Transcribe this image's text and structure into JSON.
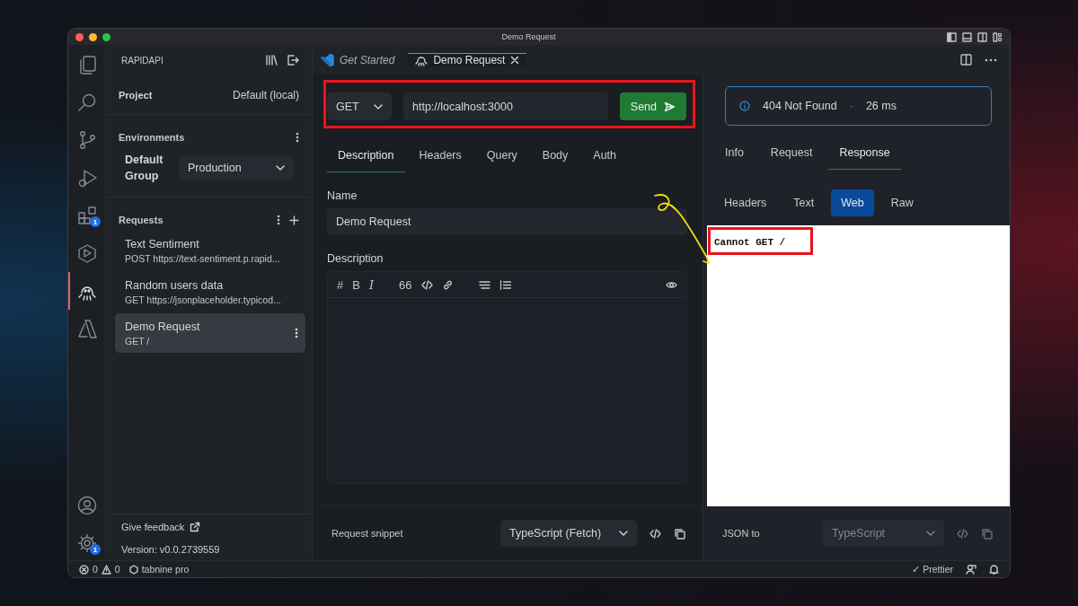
{
  "window": {
    "title": "Demo Request"
  },
  "activity_bar": {
    "items": [
      {
        "kind": "files",
        "selected": false
      },
      {
        "kind": "search",
        "selected": false
      },
      {
        "kind": "source-control",
        "selected": false
      },
      {
        "kind": "run",
        "selected": false
      },
      {
        "kind": "extensions",
        "selected": false,
        "badge": "1"
      },
      {
        "kind": "hexagon",
        "selected": false
      },
      {
        "kind": "rapidapi",
        "selected": true
      },
      {
        "kind": "azure",
        "selected": false
      }
    ],
    "bottom_items": [
      {
        "kind": "account",
        "selected": false
      },
      {
        "kind": "settings",
        "selected": false,
        "badge": "1"
      }
    ]
  },
  "sidebar": {
    "title": "RAPIDAPI",
    "project": {
      "label": "Project",
      "value": "Default (local)"
    },
    "environments": {
      "title": "Environments",
      "group": "Default Group",
      "value": "Production"
    },
    "requests": {
      "title": "Requests",
      "items": [
        {
          "name": "Text Sentiment",
          "subtitle": "POST https://text-sentiment.p.rapid...",
          "selected": false
        },
        {
          "name": "Random users data",
          "subtitle": "GET https://jsonplaceholder.typicod...",
          "selected": false
        },
        {
          "name": "Demo Request",
          "subtitle": "GET /",
          "selected": true
        }
      ]
    },
    "feedback": "Give feedback",
    "version": "Version: v0.0.2739559"
  },
  "tabs": [
    {
      "label": "Get Started",
      "kind": "welcome",
      "selected": false
    },
    {
      "label": "Demo Request",
      "kind": "request",
      "selected": true
    }
  ],
  "request": {
    "method": "GET",
    "url": "http://localhost:3000",
    "send": "Send",
    "tabs": [
      {
        "label": "Description",
        "selected": true
      },
      {
        "label": "Headers",
        "selected": false
      },
      {
        "label": "Query",
        "selected": false
      },
      {
        "label": "Body",
        "selected": false
      },
      {
        "label": "Auth",
        "selected": false
      }
    ],
    "name_label": "Name",
    "name_value": "Demo Request",
    "description_label": "Description",
    "toolbar": [
      {
        "kind": "glyph",
        "text": "#"
      },
      {
        "kind": "glyph",
        "text": "B"
      },
      {
        "kind": "italic",
        "text": "I"
      },
      {
        "kind": "gap"
      },
      {
        "kind": "glyph",
        "text": "66"
      },
      {
        "kind": "code"
      },
      {
        "kind": "link"
      },
      {
        "kind": "gap"
      },
      {
        "kind": "bullets"
      },
      {
        "kind": "numbers"
      }
    ],
    "snippet_label": "Request snippet",
    "snippet_language": "TypeScript (Fetch)"
  },
  "response": {
    "status": "404 Not Found",
    "separator": "·",
    "time": "26 ms",
    "tabs": [
      {
        "label": "Info",
        "selected": false
      },
      {
        "label": "Request",
        "selected": false
      },
      {
        "label": "Response",
        "selected": true
      }
    ],
    "view_tabs": [
      {
        "label": "Headers",
        "selected": false
      },
      {
        "label": "Text",
        "selected": false
      },
      {
        "label": "Web",
        "selected": true
      },
      {
        "label": "Raw",
        "selected": false
      }
    ],
    "body": "Cannot GET /",
    "json_to_label": "JSON to",
    "json_to_language": "TypeScript",
    "json_to_disabled": true
  },
  "status_bar": {
    "errors": "0",
    "warnings": "0",
    "tabnine": "tabnine pro",
    "prettier": "✓ Prettier"
  }
}
